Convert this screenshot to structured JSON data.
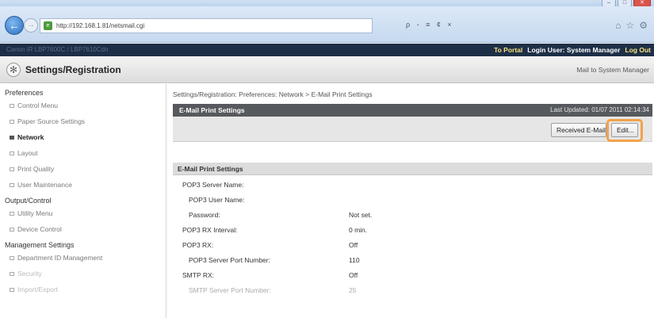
{
  "browser": {
    "url": "http://192.168.1.81/netsmail.cgi",
    "search_tools": "ρ - ≡ ¢ ×"
  },
  "header": {
    "faint_text": "Canon iR        LBP7600C / LBP7610Cdn",
    "to_portal": "To Portal",
    "login_user": "Login User: System Manager",
    "logout": "Log Out"
  },
  "title": {
    "page_title": "Settings/Registration",
    "mail_link": "Mail to System Manager"
  },
  "sidebar": {
    "groups": [
      {
        "label": "Preferences",
        "items": [
          {
            "label": "Control Menu"
          },
          {
            "label": "Paper Source Settings"
          },
          {
            "label": "Network"
          },
          {
            "label": "Layout"
          },
          {
            "label": "Print Quality"
          },
          {
            "label": "User Maintenance"
          }
        ]
      },
      {
        "label": "Output/Control",
        "items": [
          {
            "label": "Utility Menu"
          },
          {
            "label": "Device Control"
          }
        ]
      },
      {
        "label": "Management Settings",
        "items": [
          {
            "label": "Department ID Management"
          },
          {
            "label": "Security"
          },
          {
            "label": "Import/Export"
          }
        ]
      }
    ]
  },
  "main": {
    "breadcrumb": "Settings/Registration: Preferences: Network > E-Mail Print Settings",
    "panel_title": "E-Mail Print Settings",
    "last_updated": "Last Updated: 01/07 2011 02:14:34",
    "received_button": "Received E-Mail",
    "edit_button": "Edit...",
    "section_title": "E-Mail Print Settings",
    "rows": [
      {
        "label": "POP3 Server Name:",
        "value": ""
      },
      {
        "label": "POP3 User Name:",
        "value": ""
      },
      {
        "label": "Password:",
        "value": "Not set."
      },
      {
        "label": "POP3 RX Interval:",
        "value": "0 min."
      },
      {
        "label": "POP3 RX:",
        "value": "Off"
      },
      {
        "label": "POP3 Server Port Number:",
        "value": "110"
      },
      {
        "label": "SMTP RX:",
        "value": "Off"
      },
      {
        "label": "SMTP Server Port Number:",
        "value": "25"
      }
    ]
  },
  "colors": {
    "header_bg": "#1d2f47",
    "panel_head_bg": "#56595d",
    "highlight": "#f2a24a",
    "link_yellow": "#f7e27c"
  }
}
